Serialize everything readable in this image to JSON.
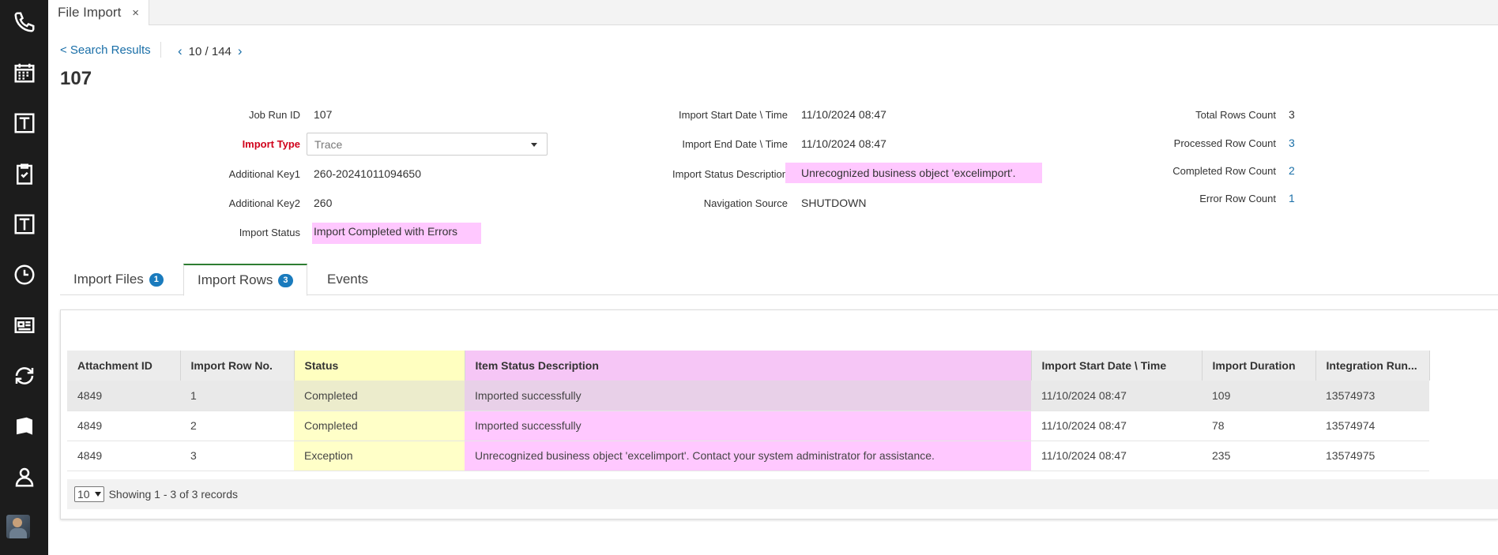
{
  "rail": {
    "icons": [
      "phone-icon",
      "calendar-icon",
      "template-icon",
      "clipboard-check-icon",
      "template-icon",
      "clock-icon",
      "newspaper-icon",
      "refresh-icon",
      "book-icon",
      "user-icon",
      "avatar"
    ]
  },
  "tabstrip": {
    "doc_tab_label": "File Import",
    "close_glyph": "×"
  },
  "nav": {
    "back_label": "< Search Results",
    "pager_count": "10 / 144",
    "prev": "‹",
    "next": "›"
  },
  "page": {
    "title": "107"
  },
  "fields": {
    "job_run_id": {
      "label": "Job Run ID",
      "value": "107"
    },
    "import_type": {
      "label": "Import Type",
      "value": "Trace"
    },
    "additional_key1": {
      "label": "Additional Key1",
      "value": "260-20241011094650"
    },
    "additional_key2": {
      "label": "Additional Key2",
      "value": "260"
    },
    "import_status": {
      "label": "Import Status",
      "value": "Import Completed with Errors"
    },
    "import_start": {
      "label": "Import Start Date \\ Time",
      "value": "11/10/2024 08:47"
    },
    "import_end": {
      "label": "Import End Date \\ Time",
      "value": "11/10/2024 08:47"
    },
    "import_status_desc": {
      "label": "Import Status Description",
      "value": "Unrecognized business object 'excelimport'."
    },
    "navigation_source": {
      "label": "Navigation Source",
      "value": "SHUTDOWN"
    },
    "total_rows": {
      "label": "Total Rows Count",
      "value": "3"
    },
    "processed_rows": {
      "label": "Processed Row Count",
      "value": "3"
    },
    "completed_rows": {
      "label": "Completed Row Count",
      "value": "2"
    },
    "error_rows": {
      "label": "Error Row Count",
      "value": "1"
    }
  },
  "subtabs": [
    {
      "label": "Import Files",
      "badge": "1"
    },
    {
      "label": "Import Rows",
      "badge": "3"
    },
    {
      "label": "Events"
    }
  ],
  "grid": {
    "columns": [
      "Attachment ID",
      "Import Row No.",
      "Status",
      "Item Status Description",
      "Import Start Date \\ Time",
      "Import Duration",
      "Integration Run..."
    ],
    "rows": [
      [
        "4849",
        "1",
        "Completed",
        "Imported successfully",
        "11/10/2024 08:47",
        "109",
        "13574973"
      ],
      [
        "4849",
        "2",
        "Completed",
        "Imported successfully",
        "11/10/2024 08:47",
        "78",
        "13574974"
      ],
      [
        "4849",
        "3",
        "Exception",
        "Unrecognized business object 'excelimport'. Contact your system administrator for assistance.",
        "11/10/2024 08:47",
        "235",
        "13574975"
      ]
    ],
    "page_size": "10",
    "summary": "Showing 1 - 3 of 3 records"
  },
  "colors": {
    "highlight_pink": "#ffc8ff",
    "highlight_yellow": "#ffffc8",
    "link": "#1a6fa8",
    "badge": "#1a7bbd",
    "required": "#d0021b"
  }
}
